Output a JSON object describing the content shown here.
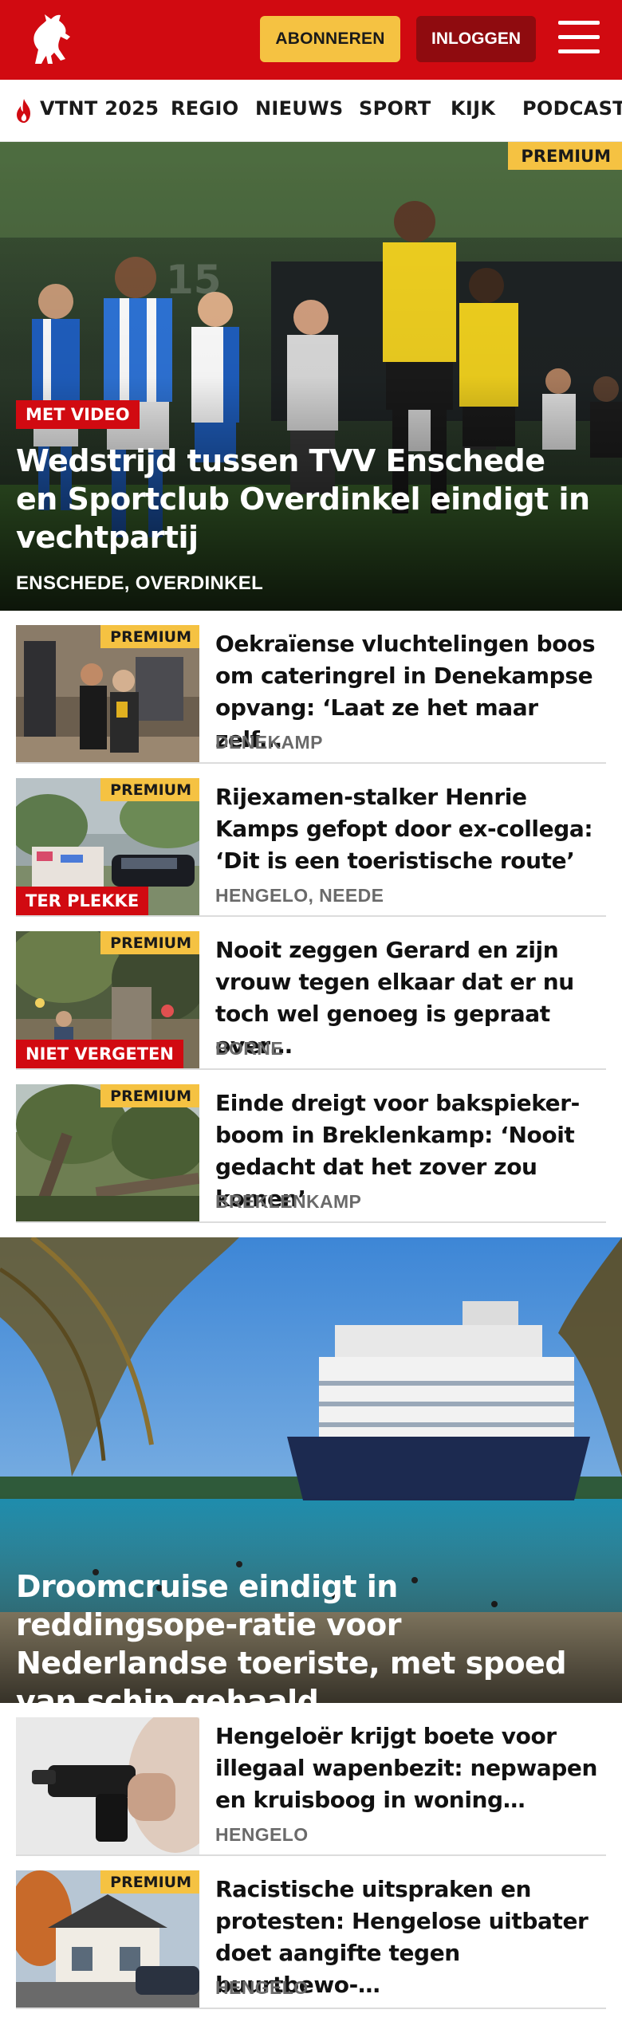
{
  "header": {
    "subscribe_label": "ABONNEREN",
    "login_label": "INLOGGEN"
  },
  "nav": {
    "items": [
      "VTNT 2025",
      "REGIO",
      "NIEUWS",
      "SPORT",
      "KIJK",
      "PODCAST"
    ]
  },
  "hero": {
    "premium": "PREMIUM",
    "badge": "MET VIDEO",
    "title": "Wedstrijd tussen TVV Enschede en Sportclub Overdinkel eindigt in vechtpartij",
    "location": "ENSCHEDE, OVERDINKEL"
  },
  "articles": [
    {
      "premium": "PREMIUM",
      "title": "Oekraïense vluchtelingen boos om cateringrel in Denekampse opvang: ‘Laat ze het maar zelf…",
      "location": "DENEKAMP"
    },
    {
      "premium": "PREMIUM",
      "badge": "TER PLEKKE",
      "title": "Rijexamen-stalker Henrie Kamps gefopt door ex-collega: ‘Dit is een toeristische route’",
      "location": "HENGELO, NEEDE"
    },
    {
      "premium": "PREMIUM",
      "badge": "NIET VERGETEN",
      "title": "Nooit zeggen Gerard en zijn vrouw tegen elkaar dat er nu toch wel genoeg is gepraat over…",
      "location": "BORNE"
    },
    {
      "premium": "PREMIUM",
      "title": "Einde dreigt voor bakspieker-boom in Breklenkamp: ‘Nooit gedacht dat het zover zou komen’",
      "location": "BREKLENKAMP"
    }
  ],
  "feature": {
    "title": "Droomcruise eindigt in reddingsope-ratie voor Nederlandse toeriste, met spoed van schip gehaald"
  },
  "articles2": [
    {
      "title": "Hengeloër krijgt boete voor illegaal wapenbezit: nepwapen en kruisboog in woning…",
      "location": "HENGELO"
    },
    {
      "premium": "PREMIUM",
      "title": "Racistische uitspraken en protesten: Hengelose uitbater doet aangifte tegen buurtbewo-…",
      "location": "HENGELO"
    }
  ],
  "colors": {
    "brand_red": "#d10a11",
    "premium_yellow": "#f5c242",
    "login_dark_red": "#8f0b0f"
  }
}
